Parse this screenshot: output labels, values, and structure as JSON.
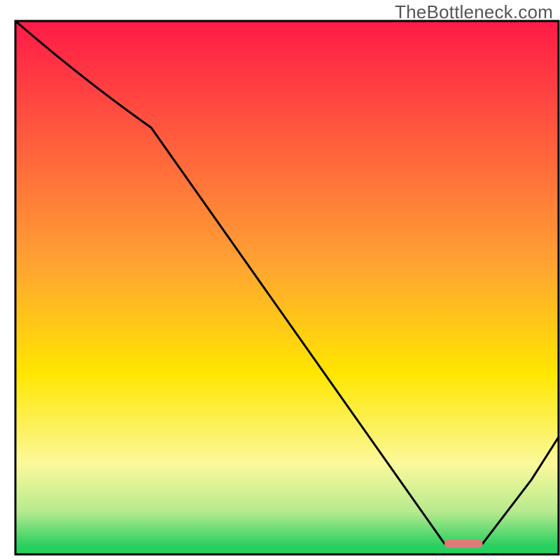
{
  "watermark": "TheBottleneck.com",
  "chart_data": {
    "type": "line",
    "title": "",
    "xlabel": "",
    "ylabel": "",
    "xlim": [
      0,
      100
    ],
    "ylim": [
      0,
      100
    ],
    "x": [
      0,
      25,
      79,
      86,
      95,
      100
    ],
    "values": [
      100,
      80,
      2,
      2,
      14,
      22
    ],
    "marker": {
      "x_start": 79,
      "x_end": 86,
      "y": 2
    },
    "gradient_stops": [
      {
        "offset": 0.0,
        "color": "#ff1a47"
      },
      {
        "offset": 0.45,
        "color": "#ffa133"
      },
      {
        "offset": 0.66,
        "color": "#ffe600"
      },
      {
        "offset": 0.83,
        "color": "#fbf99b"
      },
      {
        "offset": 0.92,
        "color": "#b6ea8e"
      },
      {
        "offset": 0.985,
        "color": "#27cf5f"
      },
      {
        "offset": 1.0,
        "color": "#27cf5f"
      }
    ]
  }
}
